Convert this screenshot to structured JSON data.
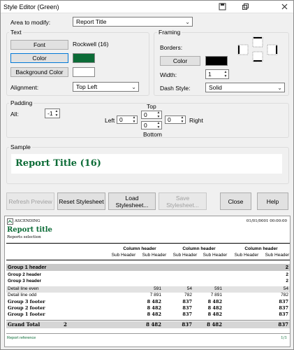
{
  "window": {
    "title": "Style Editor (Green)"
  },
  "area": {
    "label": "Area to modify:",
    "value": "Report Title"
  },
  "text_group": {
    "title": "Text",
    "font_button": "Font",
    "font_value": "Rockwell (16)",
    "color_button": "Color",
    "color_swatch": "#0b6b36",
    "bg_button": "Background Color",
    "bg_swatch": "#ffffff",
    "alignment_label": "Alignment:",
    "alignment_value": "Top Left"
  },
  "framing_group": {
    "title": "Framing",
    "borders_label": "Borders:",
    "color_button": "Color",
    "color_swatch": "#000000",
    "width_label": "Width:",
    "width_value": "1",
    "dash_label": "Dash Style:",
    "dash_value": "Solid"
  },
  "padding_group": {
    "title": "Padding",
    "all_label": "All:",
    "all_value": "-1",
    "top_label": "Top",
    "top_value": "0",
    "left_label": "Left",
    "left_value": "0",
    "right_label": "Right",
    "right_value": "0",
    "bottom_label": "Bottom",
    "bottom_value": "0"
  },
  "sample_group": {
    "title": "Sample",
    "text": "Report Title (16)",
    "text_color": "#0b6b36"
  },
  "buttons": {
    "refresh": "Refresh Preview",
    "reset": "Reset Stylesheet",
    "load": "Load Stylesheet...",
    "save": "Save Stylesheet...",
    "close": "Close",
    "help": "Help"
  },
  "preview": {
    "header_left": "ASCENDING",
    "header_date": "01/01/0001 00:00:00",
    "title": "Report title",
    "subtitle": "Reports selection",
    "column_header": "Column header",
    "sub_header": "Sub Header",
    "rows": [
      {
        "label": "Group 1 header",
        "extra": "",
        "values": [
          "",
          "",
          "",
          "",
          "",
          "2"
        ],
        "style": "g1"
      },
      {
        "label": "Group 2 header",
        "extra": "",
        "values": [
          "",
          "",
          "",
          "",
          "",
          "2"
        ],
        "style": "g"
      },
      {
        "label": "Group 3 header",
        "extra": "",
        "values": [
          "",
          "",
          "",
          "",
          "",
          "2"
        ],
        "style": "g"
      },
      {
        "label": "Detail line even",
        "extra": "",
        "values": [
          "",
          "591",
          "54",
          "591",
          "",
          "54"
        ],
        "style": "even"
      },
      {
        "label": "Detail line odd",
        "extra": "",
        "values": [
          "",
          "7 891",
          "782",
          "7 891",
          "",
          "782"
        ],
        "style": "odd"
      },
      {
        "label": "Group 3 footer",
        "extra": "",
        "values": [
          "",
          "8 482",
          "837",
          "8 482",
          "",
          "837"
        ],
        "style": "f"
      },
      {
        "label": "Group 2 footer",
        "extra": "",
        "values": [
          "",
          "8 482",
          "837",
          "8 482",
          "",
          "837"
        ],
        "style": "f"
      },
      {
        "label": "Group 1 footer",
        "extra": "",
        "values": [
          "",
          "8 482",
          "837",
          "8 482",
          "",
          "837"
        ],
        "style": "f"
      },
      {
        "label": "Grand Total",
        "extra": "2",
        "values": [
          "",
          "8 482",
          "837",
          "8 482",
          "",
          "837"
        ],
        "style": "total"
      }
    ],
    "footer_left": "Report reference",
    "footer_right": "1/1"
  }
}
